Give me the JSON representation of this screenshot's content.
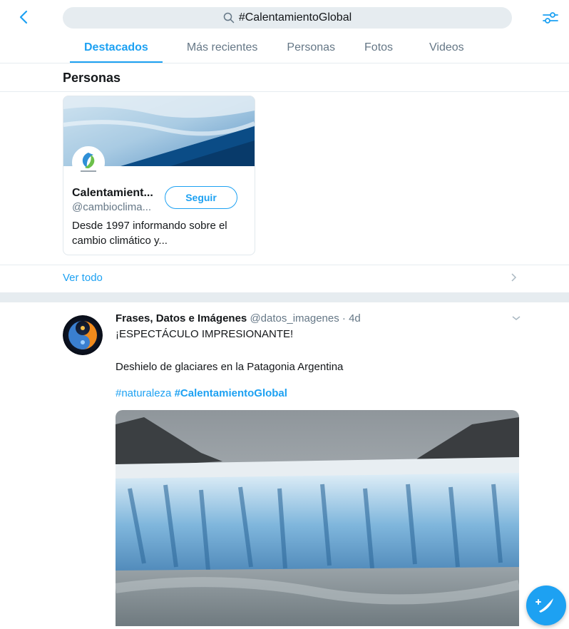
{
  "header": {
    "search_query": "#CalentamientoGlobal"
  },
  "tabs": [
    {
      "label": "Destacados"
    },
    {
      "label": "Más recientes"
    },
    {
      "label": "Personas"
    },
    {
      "label": "Fotos"
    },
    {
      "label": "Videos"
    }
  ],
  "people": {
    "section_title": "Personas",
    "card": {
      "name": "Calentamient...",
      "handle": "@cambioclima...",
      "follow_label": "Seguir",
      "bio": "Desde 1997 informando sobre el cambio climático y..."
    },
    "see_all_label": "Ver todo"
  },
  "tweet": {
    "author_name": "Frases, Datos e Imágenes",
    "author_handle": "@datos_imagenes",
    "separator": "·",
    "age": "4d",
    "line1": "¡ESPECTÁCULO IMPRESIONANTE!",
    "line2": "Deshielo de glaciares en la Patagonia Argentina",
    "hashtag1": "#naturaleza",
    "hashtag2": "#CalentamientoGlobal"
  },
  "colors": {
    "accent": "#1da1f2",
    "muted_text": "#657786",
    "divider": "#e6ecf0"
  },
  "icons": {
    "back": "chevron-left-icon",
    "search": "search-icon",
    "filter": "filter-sliders-icon",
    "tweet_menu": "chevron-down-icon",
    "compose": "compose-tweet-icon"
  }
}
